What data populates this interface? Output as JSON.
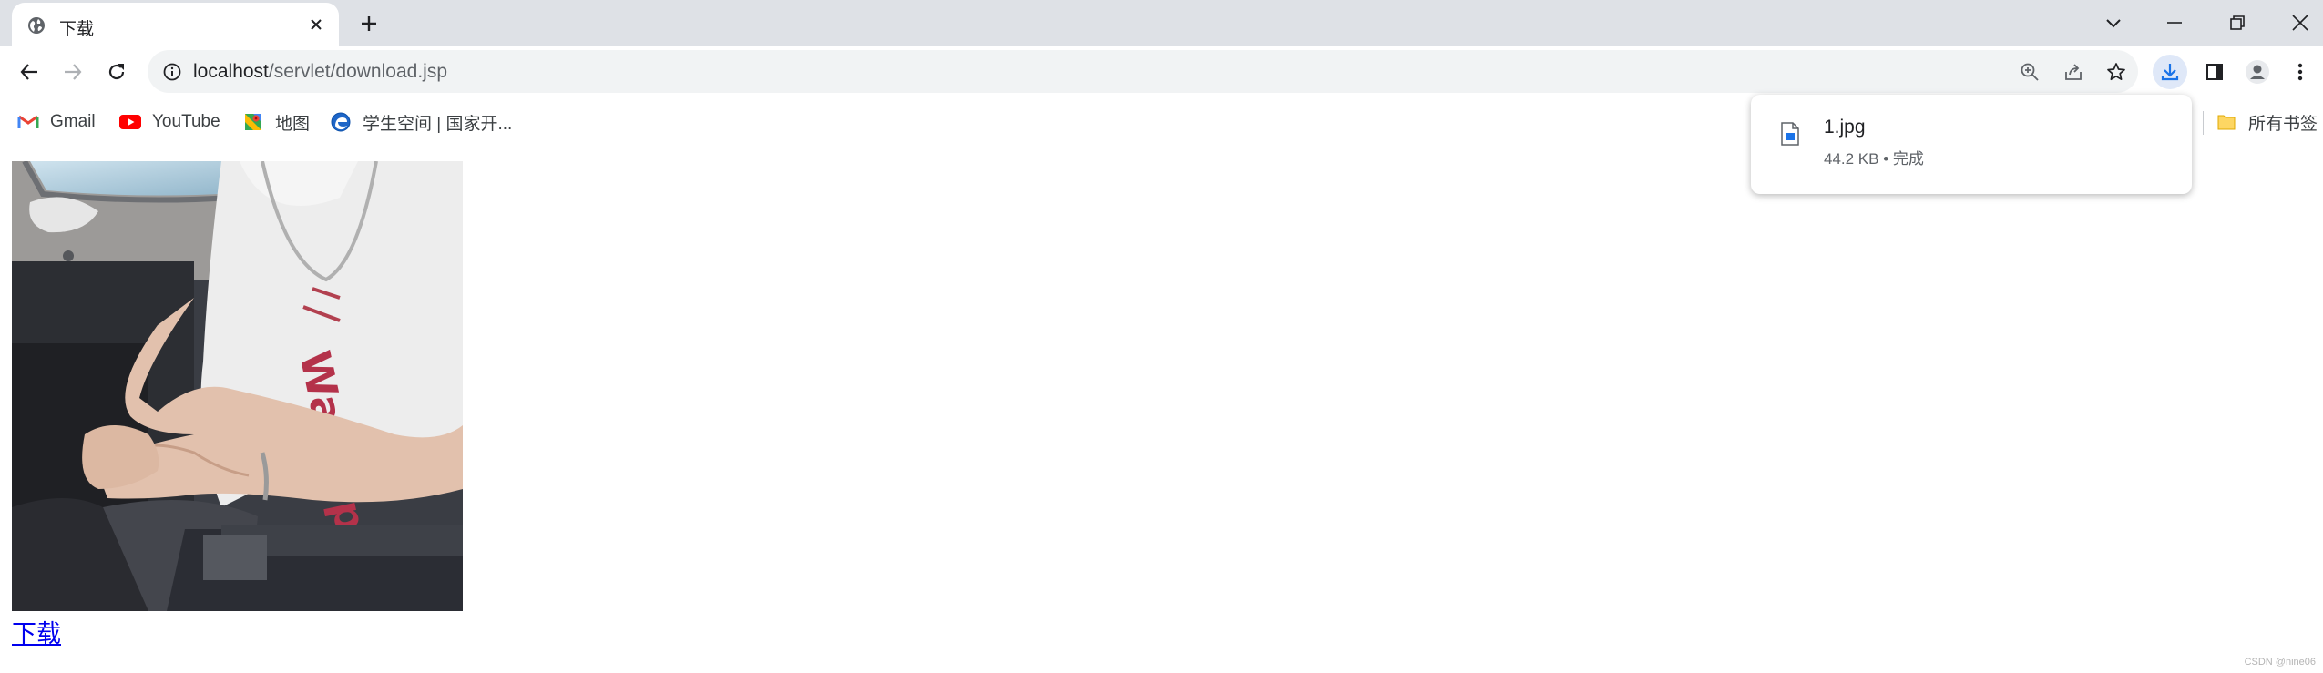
{
  "tab": {
    "title": "下载"
  },
  "address_bar": {
    "host": "localhost",
    "path": "/servlet/download.jsp"
  },
  "bookmarks": {
    "items": [
      {
        "label": "Gmail",
        "icon": "gmail-icon"
      },
      {
        "label": "YouTube",
        "icon": "youtube-icon"
      },
      {
        "label": "地图",
        "icon": "maps-icon"
      },
      {
        "label": "学生空间 | 国家开...",
        "icon": "edge-icon"
      }
    ],
    "all_bookmarks": "所有书签"
  },
  "download_bubble": {
    "file_name": "1.jpg",
    "status": "44.2 KB • 完成"
  },
  "page": {
    "link_text": "下载",
    "watermark": "CSDN @nine06"
  },
  "colors": {
    "tabstrip": "#dee1e6",
    "omnibox": "#f1f3f4",
    "accent": "#1a73e8",
    "link": "#0000ee"
  }
}
